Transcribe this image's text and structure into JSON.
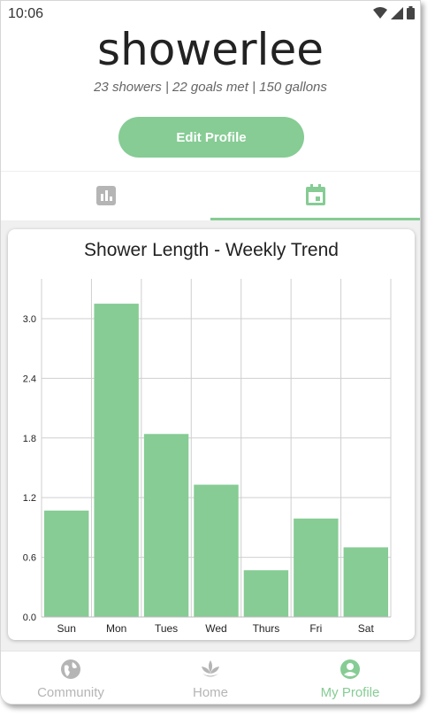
{
  "status_bar": {
    "time": "10:06",
    "icons": [
      "wifi-icon",
      "signal-icon",
      "battery-icon"
    ]
  },
  "profile": {
    "username": "showerlee",
    "stats": "23 showers | 22 goals met | 150 gallons",
    "edit_button": "Edit Profile"
  },
  "tabs": [
    {
      "icon": "bar-chart-icon",
      "active": false
    },
    {
      "icon": "calendar-icon",
      "active": true
    }
  ],
  "chart_data": {
    "type": "bar",
    "title": "Shower Length - Weekly Trend",
    "categories": [
      "Sun",
      "Mon",
      "Tues",
      "Wed",
      "Thurs",
      "Fri",
      "Sat"
    ],
    "values": [
      1.07,
      3.15,
      1.84,
      1.33,
      0.47,
      0.99,
      0.7
    ],
    "yticks": [
      "0.0",
      "0.6",
      "1.2",
      "1.8",
      "2.4",
      "3.0"
    ],
    "ylim": [
      0,
      3.4
    ],
    "grid": true,
    "bar_color": "#86cc94",
    "xlabel": "",
    "ylabel": ""
  },
  "bottom_nav": [
    {
      "label": "Community",
      "icon": "globe-icon",
      "active": false
    },
    {
      "label": "Home",
      "icon": "lotus-icon",
      "active": false
    },
    {
      "label": "My Profile",
      "icon": "account-circle-icon",
      "active": true
    }
  ],
  "colors": {
    "accent": "#86cc94",
    "inactive": "#b5b5b5"
  }
}
